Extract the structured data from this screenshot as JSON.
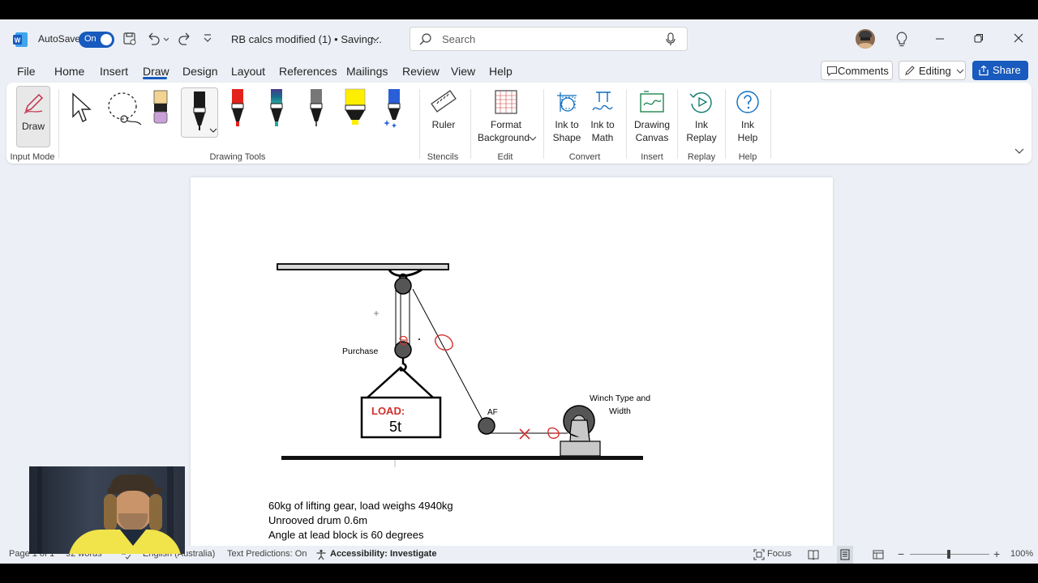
{
  "titlebar": {
    "app_icon": "word-icon",
    "autosave_label": "AutoSave",
    "autosave_state": "On",
    "doc_title": "RB calcs modified (1) • Saving...",
    "search_placeholder": "Search"
  },
  "menu": {
    "tabs": [
      "File",
      "Home",
      "Insert",
      "Draw",
      "Design",
      "Layout",
      "References",
      "Mailings",
      "Review",
      "View",
      "Help"
    ],
    "active": "Draw",
    "comments_label": "Comments",
    "editing_label": "Editing",
    "share_label": "Share"
  },
  "ribbon": {
    "draw_label": "Draw",
    "groups": {
      "input_mode": "Input Mode",
      "drawing_tools": "Drawing Tools",
      "stencils": "Stencils",
      "edit": "Edit",
      "convert": "Convert",
      "insert": "Insert",
      "replay": "Replay",
      "help": "Help"
    },
    "ruler": "Ruler",
    "format_bg_1": "Format",
    "format_bg_2": "Background",
    "ink_shape_1": "Ink to",
    "ink_shape_2": "Shape",
    "ink_math_1": "Ink to",
    "ink_math_2": "Math",
    "canvas_1": "Drawing",
    "canvas_2": "Canvas",
    "replay_1": "Ink",
    "replay_2": "Replay",
    "help_1": "Ink",
    "help_2": "Help",
    "pen_colors": [
      "#e8c15a",
      "#000000",
      "#e2231a",
      "#1a4a6b",
      "#5a5a5a",
      "#ffee00",
      "#2a5fd8"
    ]
  },
  "diagram": {
    "purchase_label": "Purchase",
    "load_label": "LOAD:",
    "load_value": "5t",
    "af_label": "AF",
    "winch_label_1": "Winch Type and",
    "winch_label_2": "Width"
  },
  "document": {
    "lines": [
      "60kg of lifting gear, load weighs 4940kg",
      "Unrooved drum 0.6m",
      "Angle at lead block is 60 degrees"
    ]
  },
  "status": {
    "page": "Page 1 of 1",
    "words": "92 words",
    "language": "English (Australia)",
    "predictions": "Text Predictions: On",
    "accessibility": "Accessibility: Investigate",
    "focus": "Focus",
    "zoom": "100%"
  }
}
